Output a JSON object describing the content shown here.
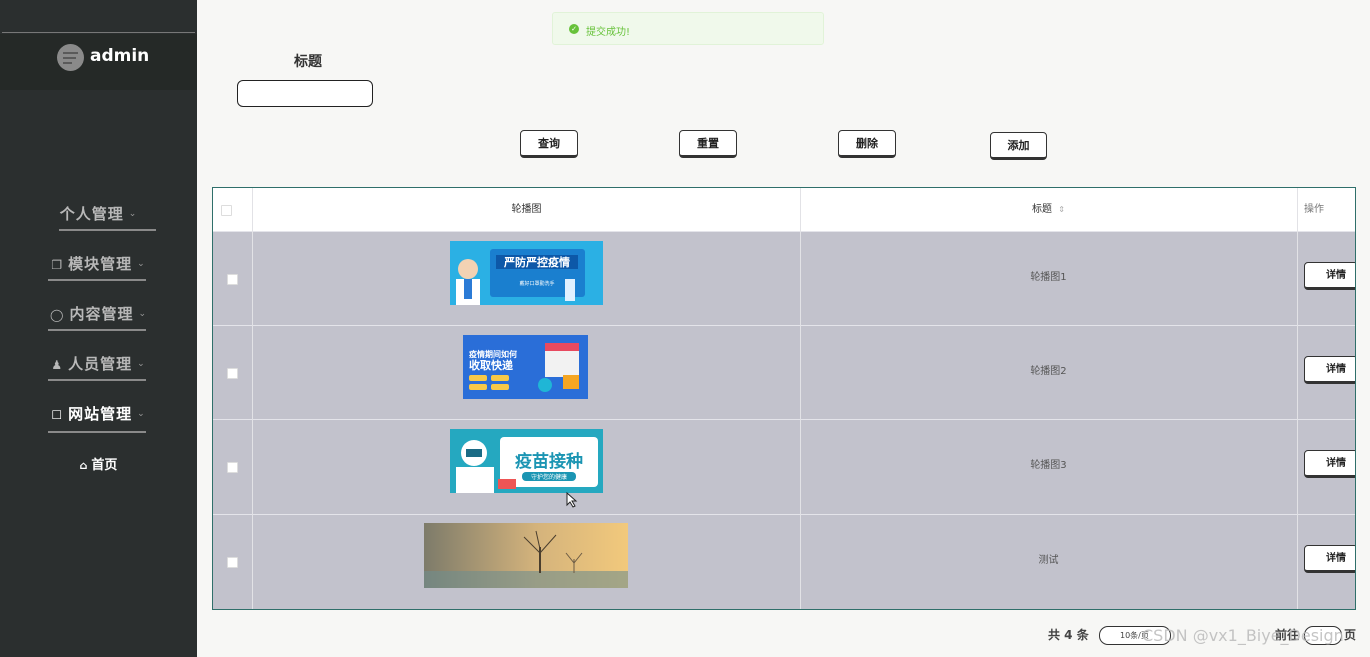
{
  "sidebar": {
    "username": "admin",
    "menu": [
      {
        "label": "个人管理",
        "icon": ""
      },
      {
        "label": "模块管理",
        "icon": "copy-icon"
      },
      {
        "label": "内容管理",
        "icon": "chat-icon"
      },
      {
        "label": "人员管理",
        "icon": "user-icon"
      },
      {
        "label": "网站管理",
        "icon": "comment-icon"
      }
    ],
    "home": "首页"
  },
  "toast": {
    "message": "提交成功!",
    "color": "#67c23a"
  },
  "search": {
    "label": "标题",
    "value": ""
  },
  "buttons": {
    "query": "查询",
    "reset": "重置",
    "delete": "删除",
    "add": "添加"
  },
  "table": {
    "headers": {
      "image": "轮播图",
      "title": "标题",
      "actions": "操作"
    },
    "detail_label": "详情",
    "rows": [
      {
        "title": "轮播图1",
        "image_text": [
          "严防严控疫情",
          "戴好口罩勤洗手"
        ]
      },
      {
        "title": "轮播图2",
        "image_text": [
          "疫情期间如何",
          "收取快递"
        ]
      },
      {
        "title": "轮播图3",
        "image_text": [
          "疫苗接种",
          "守护您的健康"
        ]
      },
      {
        "title": "测试",
        "image_text": []
      }
    ]
  },
  "pagination": {
    "total": "共 4 条",
    "page_size": "10条/页",
    "goto": "前往",
    "page_suffix": "页"
  },
  "watermark": "CSDN @vx1_Biye_Design"
}
